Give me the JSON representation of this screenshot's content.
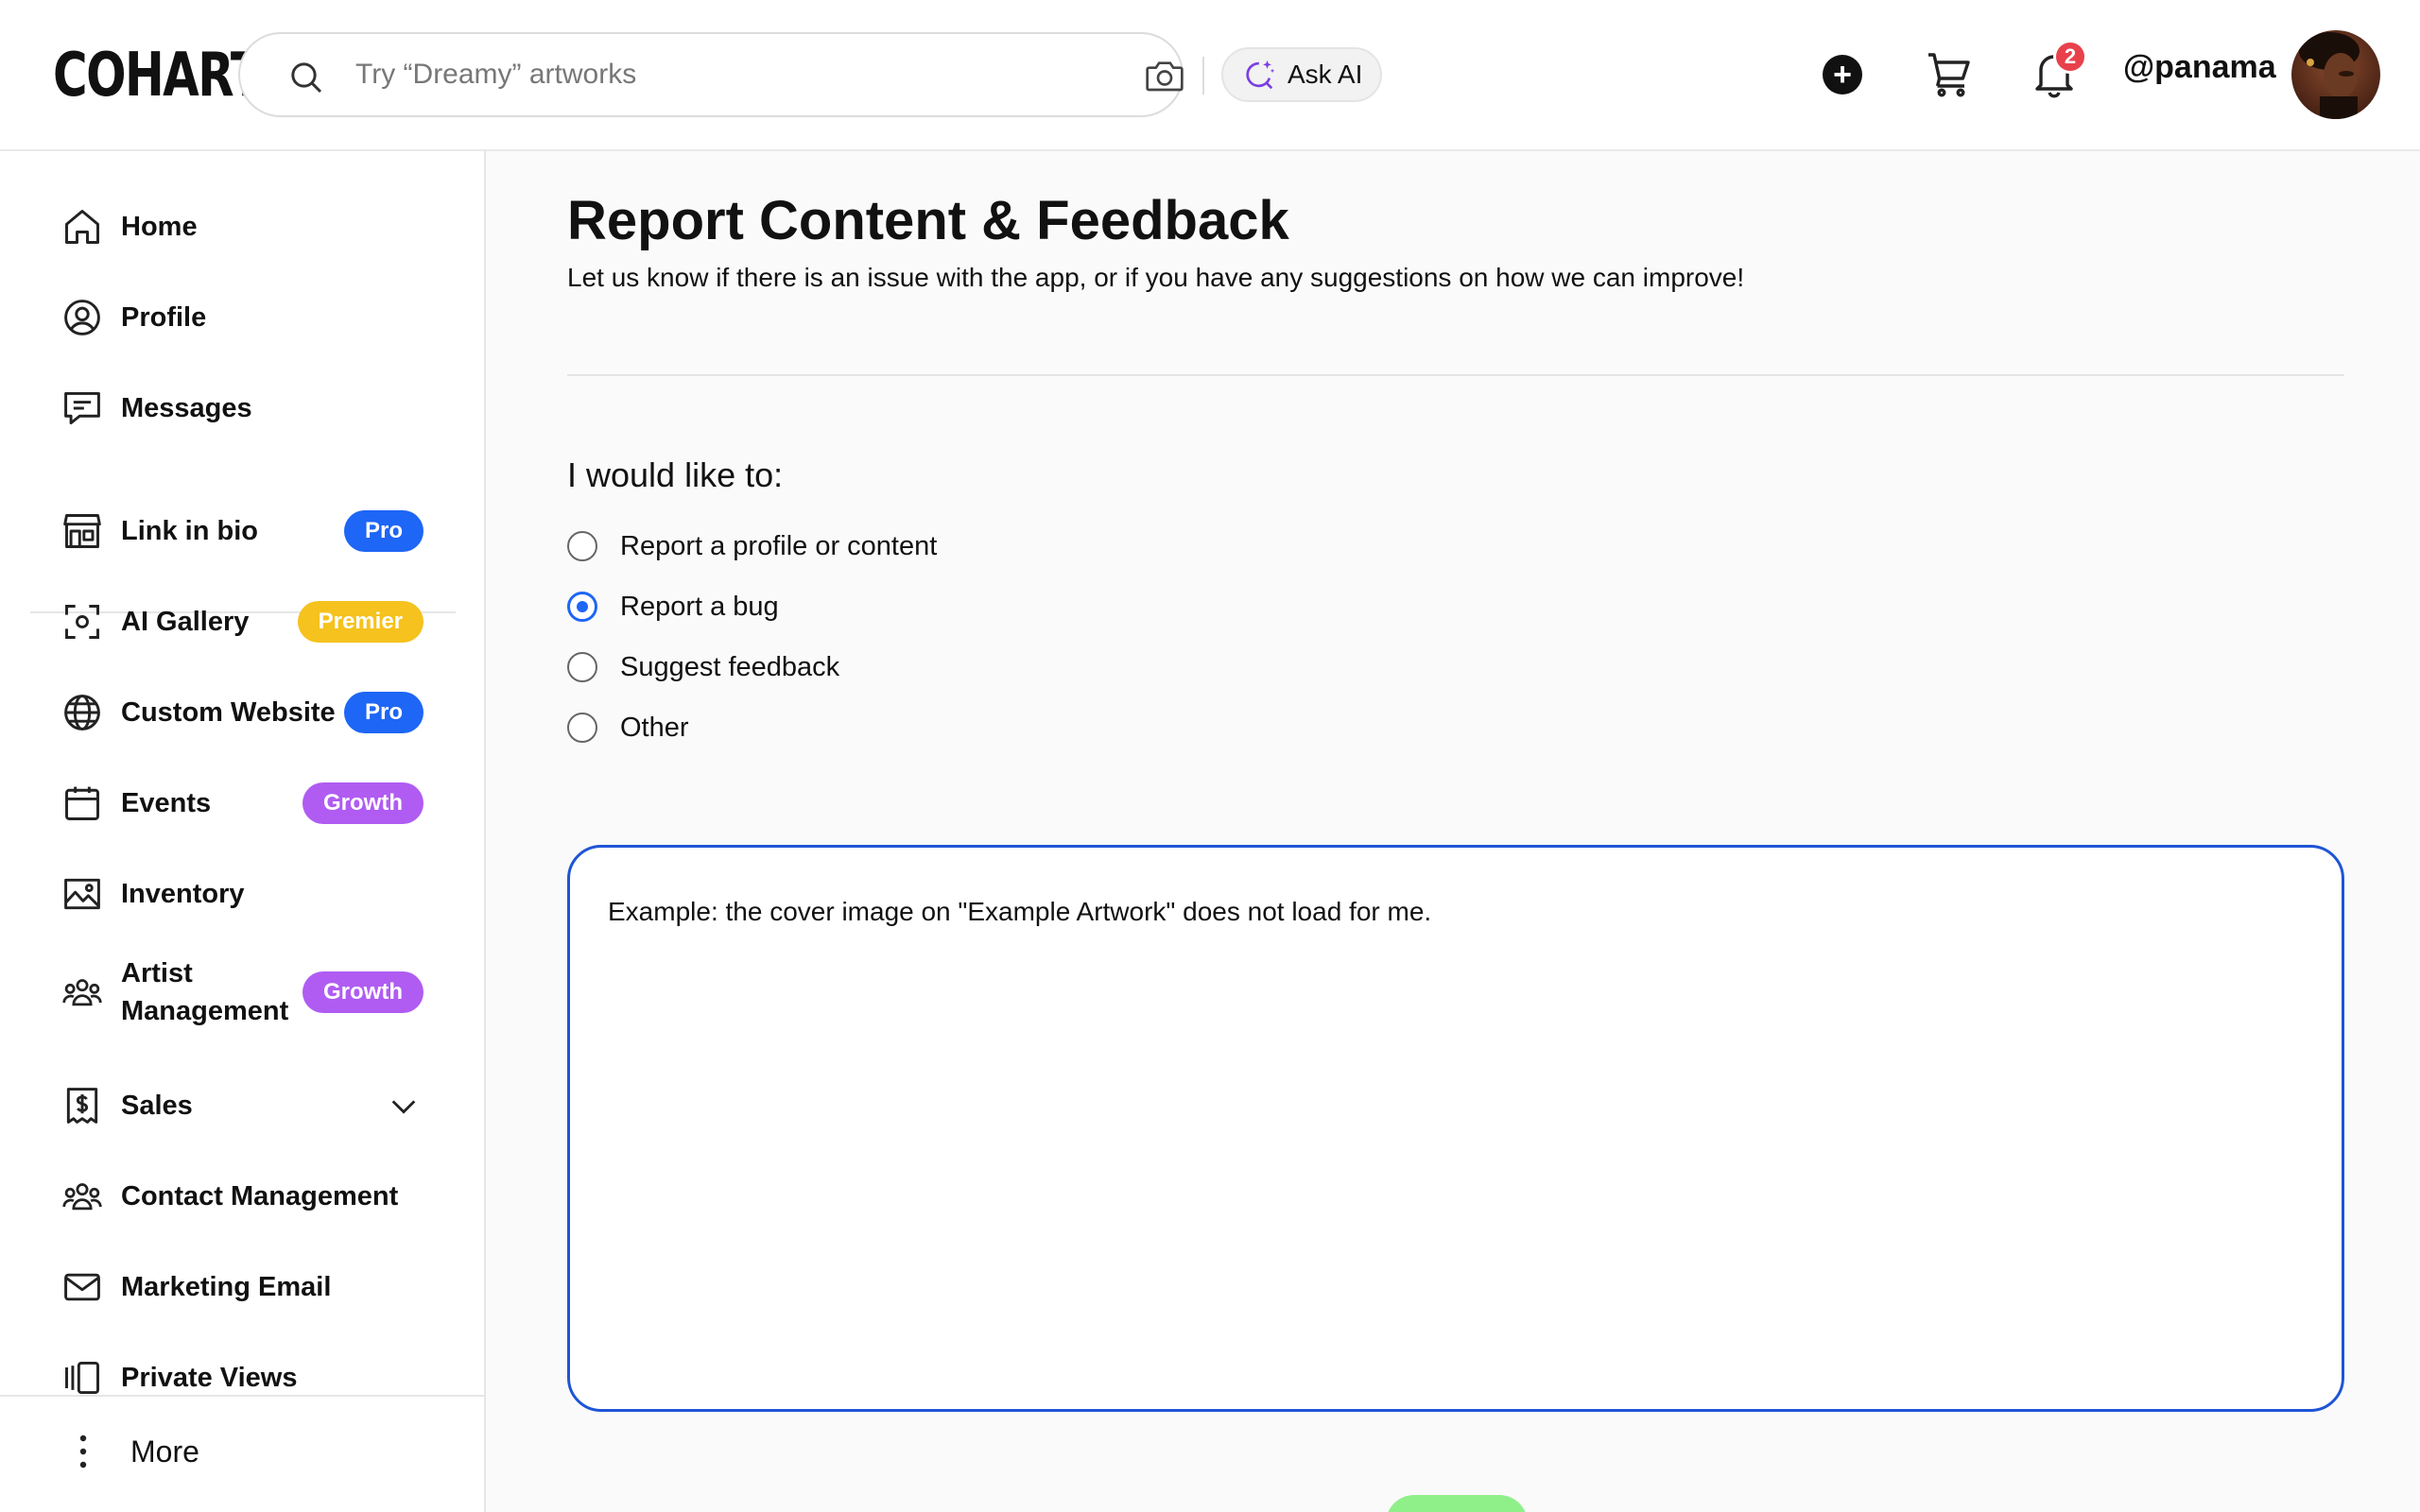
{
  "header": {
    "logo": "COHART",
    "search_placeholder": "Try “Dreamy” artworks",
    "ask_ai_label": "Ask AI",
    "notification_count": "2",
    "username": "@panama"
  },
  "sidebar": {
    "primary": [
      {
        "label": "Home",
        "icon": "home-icon"
      },
      {
        "label": "Profile",
        "icon": "user-circle-icon"
      },
      {
        "label": "Messages",
        "icon": "message-icon"
      }
    ],
    "items": [
      {
        "label": "Link in bio",
        "icon": "storefront-icon",
        "badge": "Pro"
      },
      {
        "label": "AI Gallery",
        "icon": "scan-icon",
        "badge": "Premier"
      },
      {
        "label": "Custom Website",
        "icon": "globe-icon",
        "badge": "Pro"
      },
      {
        "label": "Events",
        "icon": "calendar-icon",
        "badge": "Growth"
      },
      {
        "label": "Inventory",
        "icon": "image-icon"
      },
      {
        "label": "Artist Management",
        "icon": "group-icon",
        "badge": "Growth"
      },
      {
        "label": "Sales",
        "icon": "dollar-receipt-icon"
      },
      {
        "label": "Contact Management",
        "icon": "contacts-icon"
      },
      {
        "label": "Marketing Email",
        "icon": "mail-icon"
      },
      {
        "label": "Private Views",
        "icon": "views-icon"
      }
    ],
    "more_label": "More"
  },
  "main": {
    "title": "Report Content & Feedback",
    "subtitle": "Let us know if there is an issue with the app, or if you have any suggestions on how we can improve!",
    "question": "I would like to:",
    "options": [
      {
        "label": "Report a profile or content",
        "selected": false
      },
      {
        "label": "Report a bug",
        "selected": true
      },
      {
        "label": "Suggest feedback",
        "selected": false
      },
      {
        "label": "Other",
        "selected": false
      }
    ],
    "textarea_value": "Example: the cover image on \"Example Artwork\" does not load for me."
  },
  "colors": {
    "accent_blue": "#1e66f5",
    "premier_yellow": "#f5c21e",
    "growth_purple": "#b05cf2",
    "notification_red": "#e8414c",
    "submit_green": "#8ff08a"
  }
}
